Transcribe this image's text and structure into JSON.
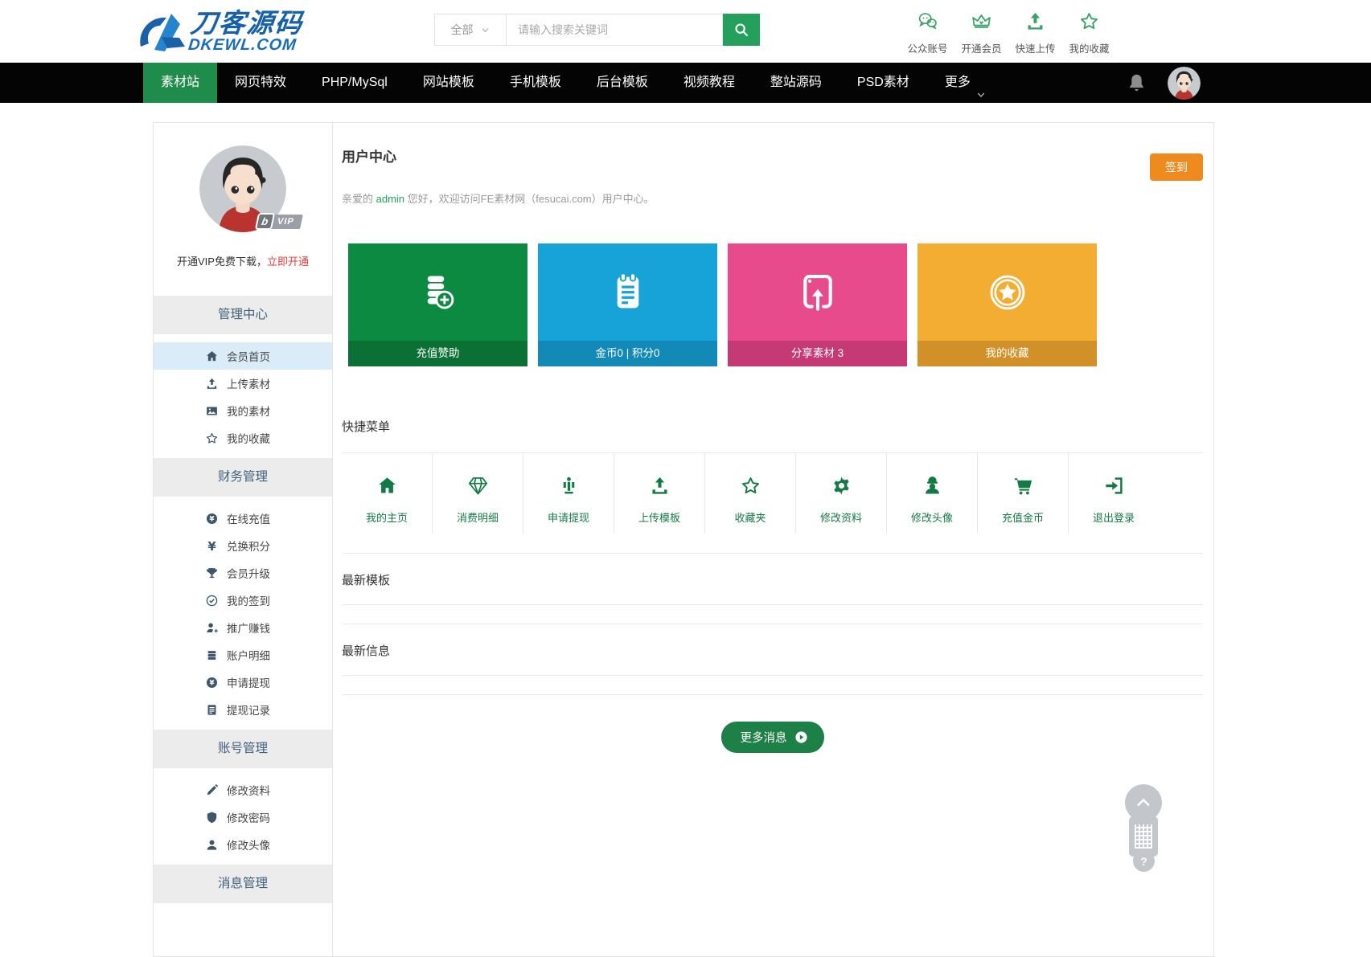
{
  "colors": {
    "accent_green": "#23a05c",
    "dark_green": "#157d44",
    "nav_active": "#1f8c4b",
    "signin_orange": "#ee8a1e"
  },
  "header": {
    "logo": {
      "title": "刀客源码",
      "subtitle": "DKEWL.COM"
    },
    "search": {
      "category": "全部",
      "placeholder": "请输入搜索关键词",
      "button_icon": "search-icon"
    },
    "quick_links": [
      {
        "label": "公众账号",
        "icon": "wechat-icon"
      },
      {
        "label": "开通会员",
        "icon": "crown-icon"
      },
      {
        "label": "快速上传",
        "icon": "upload-icon"
      },
      {
        "label": "我的收藏",
        "icon": "star-icon"
      }
    ]
  },
  "nav": {
    "items": [
      {
        "label": "素材站",
        "active": true
      },
      {
        "label": "网页特效"
      },
      {
        "label": "PHP/MySql"
      },
      {
        "label": "网站模板"
      },
      {
        "label": "手机模板"
      },
      {
        "label": "后台模板"
      },
      {
        "label": "视频教程"
      },
      {
        "label": "整站源码"
      },
      {
        "label": "PSD素材"
      }
    ],
    "more_label": "更多"
  },
  "sidebar": {
    "vip_badge": {
      "b": "b",
      "text": "VIP"
    },
    "vip_text": "开通VIP免费下载，",
    "vip_link": "立即开通",
    "sections": [
      {
        "title": "管理中心",
        "items": [
          {
            "label": "会员首页",
            "icon": "home-icon",
            "active": true
          },
          {
            "label": "上传素材",
            "icon": "upload-icon"
          },
          {
            "label": "我的素材",
            "icon": "image-icon"
          },
          {
            "label": "我的收藏",
            "icon": "star-icon"
          }
        ]
      },
      {
        "title": "财务管理",
        "items": [
          {
            "label": "在线充值",
            "icon": "yen-circle-icon"
          },
          {
            "label": "兑换积分",
            "icon": "yen-icon"
          },
          {
            "label": "会员升级",
            "icon": "trophy-icon"
          },
          {
            "label": "我的签到",
            "icon": "check-circle-icon"
          },
          {
            "label": "推广赚钱",
            "icon": "user-plus-icon"
          },
          {
            "label": "账户明细",
            "icon": "coins-icon"
          },
          {
            "label": "申请提现",
            "icon": "yen-circle-icon"
          },
          {
            "label": "提现记录",
            "icon": "document-icon"
          }
        ]
      },
      {
        "title": "账号管理",
        "items": [
          {
            "label": "修改资料",
            "icon": "pen-icon"
          },
          {
            "label": "修改密码",
            "icon": "shield-icon"
          },
          {
            "label": "修改头像",
            "icon": "user-icon"
          }
        ]
      },
      {
        "title": "消息管理",
        "items": []
      }
    ]
  },
  "main": {
    "title": "用户中心",
    "signin_label": "签到",
    "greeting": {
      "prefix": "亲爱的 ",
      "username": "admin",
      "suffix": " 您好，欢迎访问FE素材网（fesucai.com）用户中心。"
    },
    "stat_cards": [
      {
        "label": "充值赞助",
        "icon": "coins-plus-icon",
        "color": "#0d8a42",
        "footer_color": "#0b7036"
      },
      {
        "label": "金币0 | 积分0",
        "icon": "notepad-icon",
        "color": "#17a3d7",
        "footer_color": "#1289b6"
      },
      {
        "label": "分享素材 3",
        "icon": "share-device-icon",
        "color": "#e74b8b",
        "footer_color": "#c53a74"
      },
      {
        "label": "我的收藏",
        "icon": "star-badge-icon",
        "color": "#f3ad32",
        "footer_color": "#d29128"
      }
    ],
    "quick_menu": {
      "title": "快捷菜单",
      "items": [
        {
          "label": "我的主页",
          "icon": "home-icon"
        },
        {
          "label": "消费明细",
          "icon": "diamond-icon"
        },
        {
          "label": "申请提现",
          "icon": "withdraw-icon"
        },
        {
          "label": "上传模板",
          "icon": "upload-icon"
        },
        {
          "label": "收藏夹",
          "icon": "star-icon"
        },
        {
          "label": "修改资料",
          "icon": "gear-icon"
        },
        {
          "label": "修改头像",
          "icon": "avatar-hat-icon"
        },
        {
          "label": "充值金币",
          "icon": "cart-icon"
        },
        {
          "label": "退出登录",
          "icon": "logout-icon"
        }
      ]
    },
    "sections": [
      {
        "title": "最新模板"
      },
      {
        "title": "最新信息"
      }
    ],
    "more_button": {
      "label": "更多消息",
      "icon": "play-circle-icon"
    }
  },
  "floating": {
    "top_icon": "chevron-up-icon",
    "qr_icon": "qr-icon",
    "help_label": "?"
  }
}
